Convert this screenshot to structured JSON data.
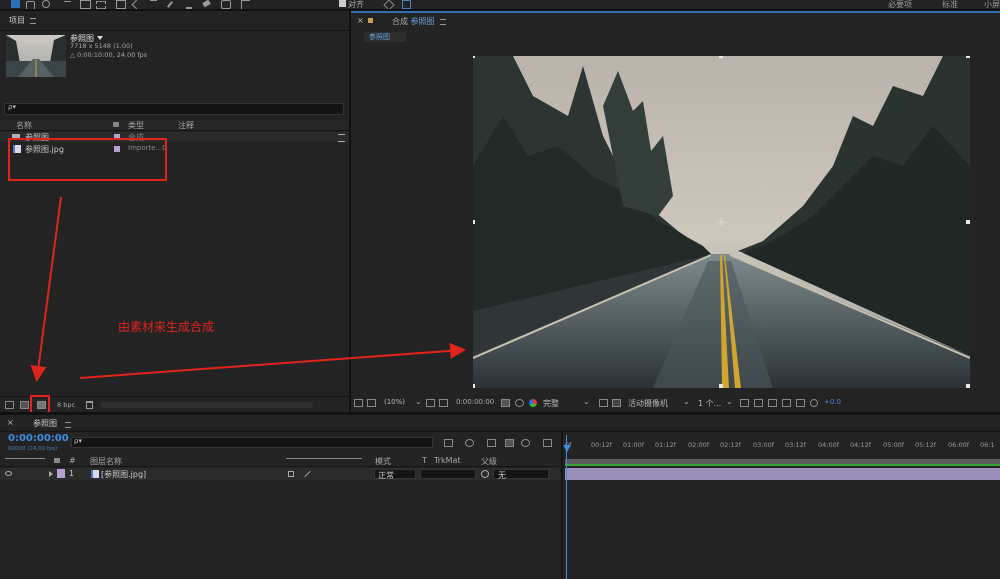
{
  "toolbar": {
    "snap_label": "对齐",
    "workspaces": [
      "必要项",
      "标准",
      "小屏"
    ]
  },
  "project_panel": {
    "tab": "项目",
    "item_name": "参照图",
    "item_dims": "7718 x 5148 (1.00)",
    "item_duration": "△ 0:00:10:00, 24.00 fps",
    "search_placeholder": "ρ▾",
    "columns": {
      "name": "名称",
      "type": "类型",
      "comment": "注释"
    },
    "rows": [
      {
        "name": "参照图",
        "type": "合成"
      },
      {
        "name": "参照图.jpg",
        "type": "Importe...G"
      }
    ],
    "bpc": "8 bpc"
  },
  "comp_panel": {
    "close": "×",
    "title_prefix": "合成",
    "title_name": "参照图",
    "subtab": "参照图",
    "zoom": "(10%)",
    "timecode": "0:00:00:00",
    "resolution": "完整",
    "camera": "活动摄像机",
    "views": "1 个...",
    "exposure": "+0.0"
  },
  "timeline": {
    "tab": "参照图",
    "timecode": "0:00:00:00",
    "frames": "00000 (24.00 fps)",
    "search_placeholder": "ρ▾",
    "columns": {
      "hash": "#",
      "layer_name": "图层名称",
      "mode": "模式",
      "t": "T",
      "trkmat": "TrkMat",
      "parent": "父级"
    },
    "layer": {
      "index": "1",
      "name": "[参照图.jpg]",
      "mode": "正常",
      "parent": "无"
    },
    "ruler": [
      "0f",
      "00:12f",
      "01:00f",
      "01:12f",
      "02:00f",
      "02:12f",
      "03:00f",
      "03:12f",
      "04:00f",
      "04:12f",
      "05:00f",
      "05:12f",
      "06:00f",
      "06:1"
    ]
  },
  "annotation": {
    "text": "由素材来生成合成",
    "color": "#e0241c"
  }
}
